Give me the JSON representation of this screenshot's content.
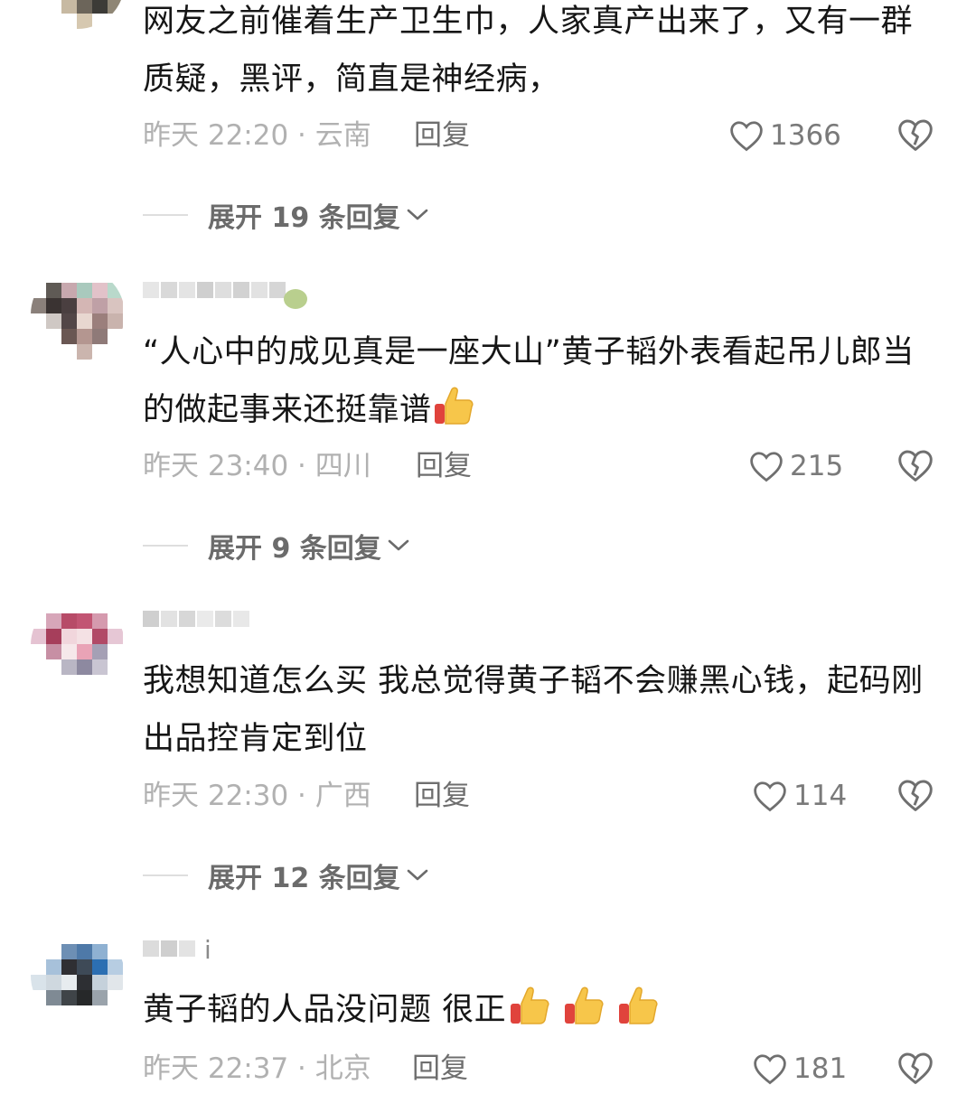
{
  "comments": [
    {
      "text": "网友之前催着生产卫生巾，人家真产出来了，又有一群质疑，黑评，简直是神经病，",
      "time_location": "昨天 22:20 · 云南",
      "reply_label": "回复",
      "likes": "1366",
      "expand_label": "展开 19 条回复"
    },
    {
      "text": "“人心中的成见真是一座大山”黄子韬外表看起吊儿郎当的做起事来还挺靠谱",
      "emojis": [
        "thumbs-up"
      ],
      "time_location": "昨天 23:40 · 四川",
      "reply_label": "回复",
      "likes": "215",
      "expand_label": "展开 9 条回复"
    },
    {
      "text": "我想知道怎么买  我总觉得黄子韬不会赚黑心钱，起码刚出品控肯定到位",
      "time_location": "昨天 22:30 · 广西",
      "reply_label": "回复",
      "likes": "114",
      "expand_label": "展开 12 条回复"
    },
    {
      "username_suffix": "i",
      "text": "黄子韬的人品没问题 很正",
      "emojis": [
        "thumbs-up",
        "thumbs-up",
        "thumbs-up"
      ],
      "time_location": "昨天 22:37 · 北京",
      "reply_label": "回复",
      "likes": "181"
    }
  ],
  "icons": {
    "like": "heart-outline-icon",
    "dislike": "broken-heart-icon",
    "expand": "chevron-down-icon",
    "emoji": "thumbs-up-emoji"
  },
  "colors": {
    "text": "#161616",
    "meta": "#b1b1b1",
    "reply": "#6e6e6e",
    "expand": "#6b6b6b",
    "thumb": "#f7c64a"
  }
}
